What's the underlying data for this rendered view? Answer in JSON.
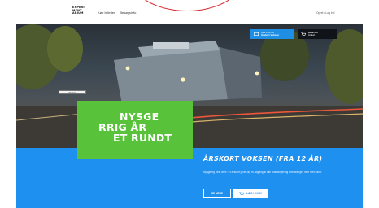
{
  "header": {
    "logo_lines": [
      "EXPERI",
      "MENT",
      "ARIUM"
    ],
    "nav_items": [
      "Køb billetter",
      "Besøgsinfo"
    ],
    "login_label": "Opret / Log ind"
  },
  "hero": {
    "button_blue_line1": "Læs mere om",
    "button_blue_line2": "Årskort Voksen",
    "button_dark_label": "KØB NU",
    "button_dark_sub": "Årskort",
    "hospital_sign": "Hospital"
  },
  "promo": {
    "lines": [
      "NYSGE",
      "RRIG ÅR",
      "ET RUNDT"
    ]
  },
  "card": {
    "title": "ÅRSKORT VOKSEN (FRA 12 ÅR)",
    "body": "Nysgerrig hele året? Et årskort giver dig fri adgang til alle udstillinger og forestillinger hele året rundt.",
    "cta_read_more": "SE MERE",
    "cta_cart": "LÆG I KURV"
  },
  "colors": {
    "accent_blue": "#1e90f0",
    "promo_green": "#57c23a",
    "arc_red": "#d8232a"
  }
}
